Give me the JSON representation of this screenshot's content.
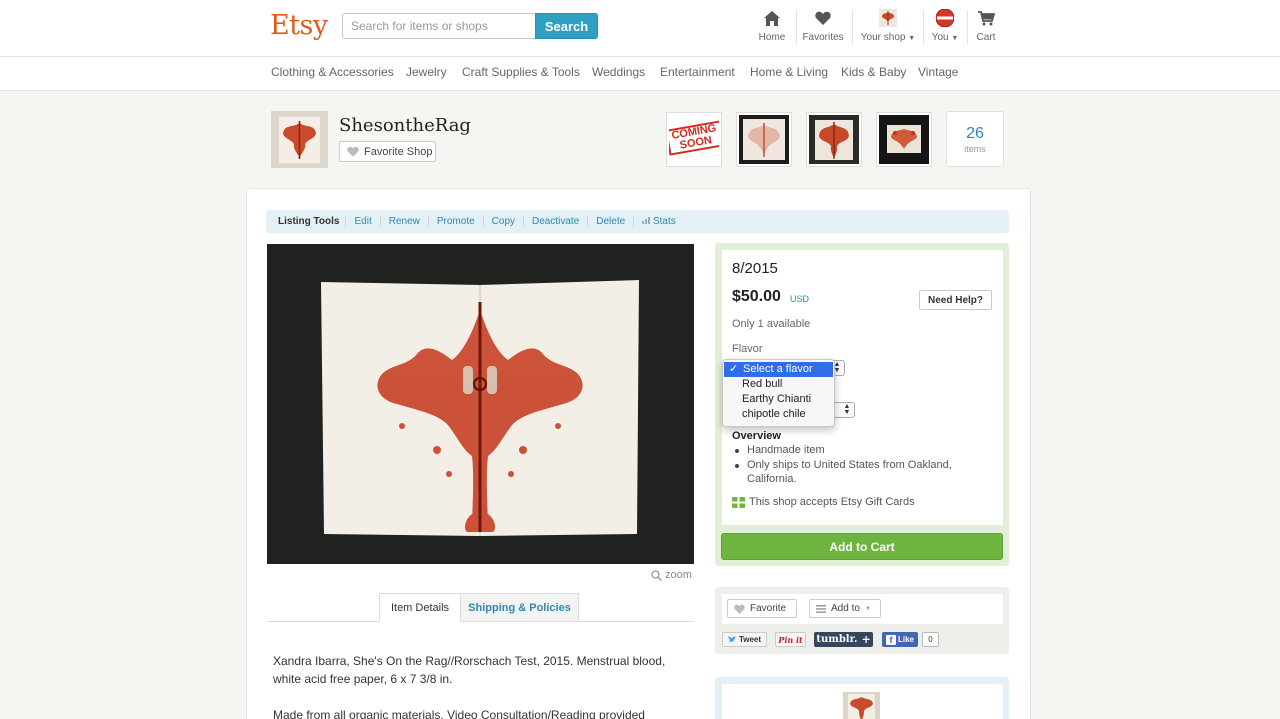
{
  "header": {
    "logo": "Etsy",
    "search_placeholder": "Search for items or shops",
    "search_button": "Search",
    "nav": {
      "home": "Home",
      "favorites": "Favorites",
      "your_shop": "Your shop",
      "you": "You",
      "cart": "Cart"
    }
  },
  "categories": [
    "Clothing & Accessories",
    "Jewelry",
    "Craft Supplies & Tools",
    "Weddings",
    "Entertainment",
    "Home & Living",
    "Kids & Baby",
    "Vintage"
  ],
  "shop": {
    "name": "ShesontheRag",
    "favorite_button": "Favorite Shop",
    "thumb1_text": "COMING SOON",
    "items_count": "26",
    "items_label": "items"
  },
  "listing_tools": {
    "label": "Listing Tools",
    "links": [
      "Edit",
      "Renew",
      "Promote",
      "Copy",
      "Deactivate",
      "Delete",
      "Stats"
    ]
  },
  "image": {
    "zoom_label": "zoom"
  },
  "tabs": {
    "item_details": "Item Details",
    "shipping": "Shipping & Policies"
  },
  "description": {
    "para1": "Xandra Ibarra, She's On the Rag//Rorschach Test, 2015. Menstrual blood, white acid free paper, 6 x 7 3/8 in.",
    "para2": "Made from all organic materials. Video Consultation/Reading provided"
  },
  "buy_box": {
    "title": "8/2015",
    "price": "$50.00",
    "currency": "USD",
    "need_help": "Need Help?",
    "availability": "Only 1 available",
    "flavor_label": "Flavor",
    "flavor_options": [
      "Select a flavor",
      "Red bull",
      "Earthy Chianti",
      "chipotle chile"
    ],
    "overview_title": "Overview",
    "overview_items": [
      "Handmade item",
      "Only ships to United States from Oakland, California."
    ],
    "gift_cards": "This shop accepts Etsy Gift Cards",
    "add_to_cart": "Add to Cart"
  },
  "social": {
    "favorite": "Favorite",
    "add_to": "Add to",
    "tweet": "Tweet",
    "pinit": "Pin it",
    "tumblr": "tumblr.",
    "like": "Like",
    "like_count": "0"
  },
  "colors": {
    "brand_orange": "#e15a1c",
    "link_blue": "#2e87b0",
    "search_blue": "#2ea0c4",
    "cart_green": "#6eb43f",
    "select_blue": "#2f6ee8"
  }
}
